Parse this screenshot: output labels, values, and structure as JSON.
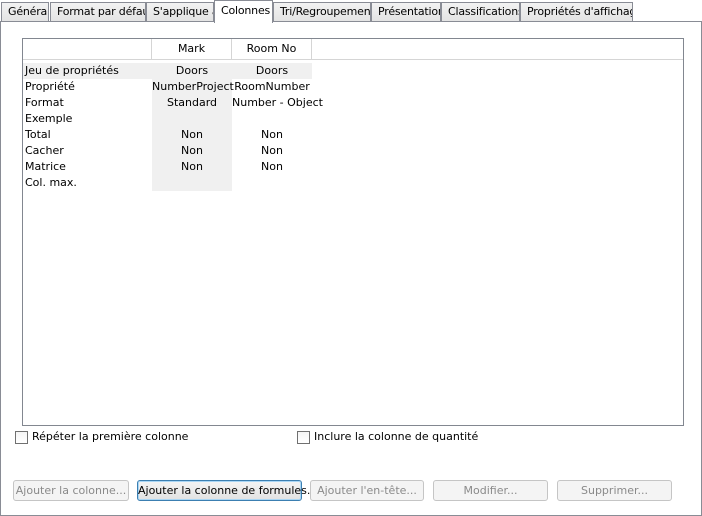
{
  "tabs": [
    {
      "label": "Général"
    },
    {
      "label": "Format par défaut"
    },
    {
      "label": "S'applique à"
    },
    {
      "label": "Colonnes"
    },
    {
      "label": "Tri/Regroupement"
    },
    {
      "label": "Présentation"
    },
    {
      "label": "Classifications"
    },
    {
      "label": "Propriétés d'affichage"
    }
  ],
  "active_tab": "Colonnes",
  "grid": {
    "columns": [
      {
        "header": "Mark"
      },
      {
        "header": "Room No"
      }
    ],
    "rows": [
      {
        "label": "Jeu de propriétés",
        "values": [
          "Doors",
          "Doors"
        ]
      },
      {
        "label": "Propriété",
        "values": [
          "NumberProject",
          "RoomNumber"
        ]
      },
      {
        "label": "Format",
        "values": [
          "Standard",
          "Number - Object"
        ]
      },
      {
        "label": "Exemple",
        "values": [
          "",
          ""
        ]
      },
      {
        "label": "Total",
        "values": [
          "Non",
          "Non"
        ]
      },
      {
        "label": "Cacher",
        "values": [
          "Non",
          "Non"
        ]
      },
      {
        "label": "Matrice",
        "values": [
          "Non",
          "Non"
        ]
      },
      {
        "label": "Col. max.",
        "values": [
          "",
          ""
        ]
      }
    ]
  },
  "options": {
    "repeat_first_column": {
      "label": "Répéter la première colonne",
      "checked": false
    },
    "include_quantity_column": {
      "label": "Inclure la colonne de quantité",
      "checked": false
    }
  },
  "buttons": {
    "add_column": {
      "label": "Ajouter la colonne...",
      "enabled": false
    },
    "add_formula_column": {
      "label": "Ajouter la colonne de formules...",
      "enabled": true
    },
    "add_header": {
      "label": "Ajouter l'en-tête...",
      "enabled": false
    },
    "modify": {
      "label": "Modifier...",
      "enabled": false
    },
    "delete": {
      "label": "Supprimer...",
      "enabled": false
    }
  }
}
